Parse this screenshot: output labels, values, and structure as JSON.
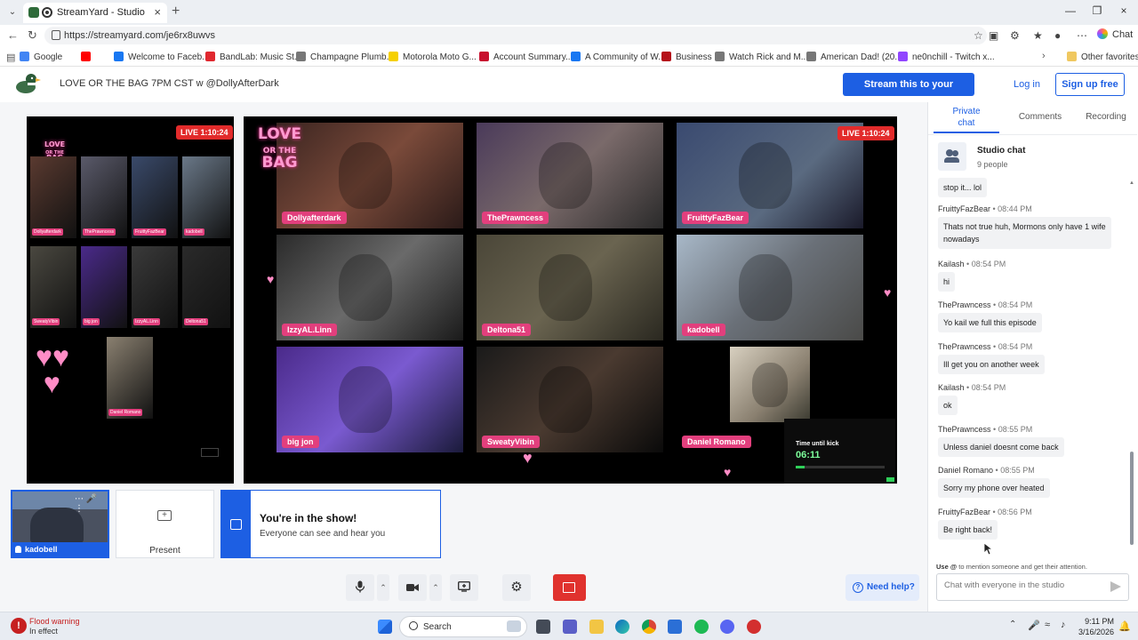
{
  "browser": {
    "tab_title": "StreamYard - Studio",
    "url": "https://streamyard.com/je6rx8uwvs",
    "chat_label": "Chat",
    "bookmarks": [
      {
        "label": "Google",
        "color": "#4285f4"
      },
      {
        "label": "",
        "color": "#ff0000"
      },
      {
        "label": "Welcome to Faceb...",
        "color": "#1877f2"
      },
      {
        "label": "BandLab: Music St...",
        "color": "#e0282f"
      },
      {
        "label": "Champagne Plumb...",
        "color": "#777777"
      },
      {
        "label": "Motorola Moto G...",
        "color": "#f5d000"
      },
      {
        "label": "Account Summary...",
        "color": "#c8102e"
      },
      {
        "label": "A Community of W...",
        "color": "#1877f2"
      },
      {
        "label": "Business",
        "color": "#b5121b"
      },
      {
        "label": "Watch Rick and M...",
        "color": "#777777"
      },
      {
        "label": "American Dad! (20...",
        "color": "#777777"
      },
      {
        "label": "ne0nchill - Twitch x...",
        "color": "#9146ff"
      }
    ],
    "other_favorites": "Other favorites"
  },
  "header": {
    "show_title": "LOVE OR THE BAG 7PM CST w @DollyAfterDark",
    "stream_button": "Stream this to your audience",
    "login": "Log in",
    "signup": "Sign up free"
  },
  "stage": {
    "live_left": "LIVE 1:10:24",
    "live_right": "LIVE 1:10:24",
    "logo_line1": "LOVE",
    "logo_line2": "OR THE",
    "logo_line3": "BAG",
    "participants": [
      "Dollyafterdark",
      "ThePrawncess",
      "FruittyFazBear",
      "IzzyAL.Linn",
      "Deltona51",
      "kadobell",
      "big jon",
      "SweatyVibin",
      "Daniel Romano"
    ],
    "mini_participants": [
      "Dollyafterdark",
      "ThePrawncess",
      "FruittyFazBear",
      "kadobell",
      "SweatyVibin",
      "big jon",
      "IzzyAL.Linn",
      "Deltona51",
      "Daniel Romano"
    ],
    "kick_label": "Time until kick",
    "kick_time": "06:11",
    "kick_progress": 0.1,
    "watermark": "shutterstock"
  },
  "tiles": {
    "self_name": "kadobell",
    "present_label": "Present",
    "show_heading": "You're in the show!",
    "show_sub": "Everyone can see and hear you"
  },
  "controls": {
    "need_help": "Need help?"
  },
  "chat": {
    "tabs": [
      {
        "label": "Private chat",
        "active": true
      },
      {
        "label": "Comments",
        "active": false
      },
      {
        "label": "Recording",
        "active": false
      }
    ],
    "studio_name": "Studio chat",
    "studio_count": "9 people",
    "messages": [
      {
        "author": "",
        "time": "",
        "text": "stop it... lol"
      },
      {
        "author": "FruittyFazBear",
        "time": "08:44 PM",
        "text": "Thats not true huh, Mormons only have 1 wife nowadays"
      },
      {
        "author": "Kailash",
        "time": "08:54 PM",
        "text": "hi"
      },
      {
        "author": "ThePrawncess",
        "time": "08:54 PM",
        "text": "Yo kail we full this episode"
      },
      {
        "author": "ThePrawncess",
        "time": "08:54 PM",
        "text": "Ill get you on another week"
      },
      {
        "author": "Kailash",
        "time": "08:54 PM",
        "text": "ok"
      },
      {
        "author": "ThePrawncess",
        "time": "08:55 PM",
        "text": "Unless daniel doesnt come back"
      },
      {
        "author": "Daniel Romano",
        "time": "08:55 PM",
        "text": "Sorry my phone over heated"
      },
      {
        "author": "FruittyFazBear",
        "time": "08:56 PM",
        "text": "Be right back!"
      }
    ],
    "hint_use": "Use @",
    "hint_rest": " to mention someone and get their attention.",
    "input_placeholder": "Chat with everyone in the studio"
  },
  "taskbar": {
    "weather_title": "Flood warning",
    "weather_sub": "In effect",
    "search_label": "Search",
    "time": "9:11 PM",
    "date": "3/16/2026"
  }
}
